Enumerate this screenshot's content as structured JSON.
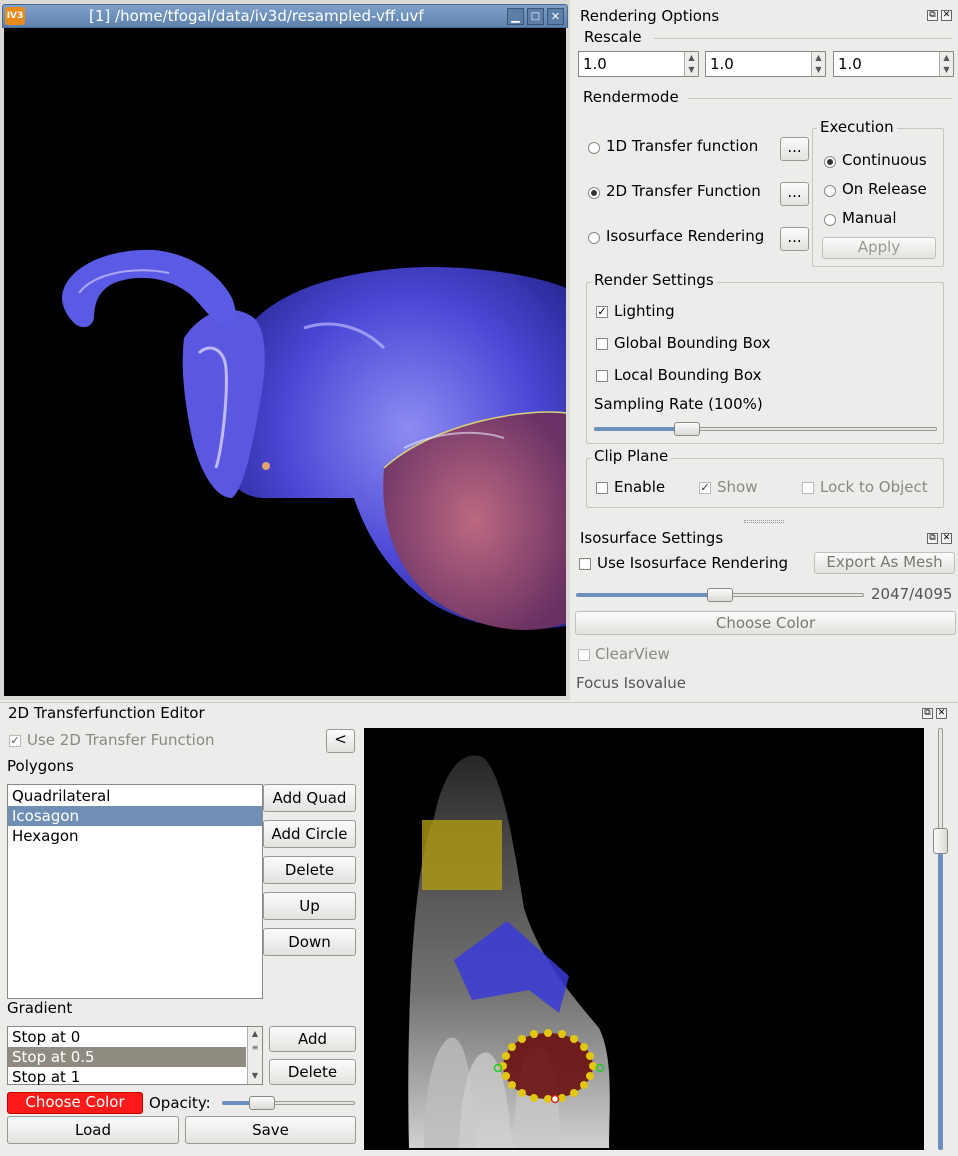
{
  "render_window": {
    "title": "[1] /home/tfogal/data/iv3d/resampled-vff.uvf",
    "logo": "IV3"
  },
  "rendering_options": {
    "title": "Rendering Options",
    "rescale_label": "Rescale",
    "rescale_values": [
      "1.0",
      "1.0",
      "1.0"
    ],
    "rendermode_label": "Rendermode",
    "modes": [
      {
        "label": "1D Transfer function",
        "selected": false
      },
      {
        "label": "2D Transfer Function",
        "selected": true
      },
      {
        "label": "Isosurface Rendering",
        "selected": false
      }
    ],
    "more_button": "...",
    "execution": {
      "label": "Execution",
      "options": [
        {
          "label": "Continuous",
          "selected": true
        },
        {
          "label": "On Release",
          "selected": false
        },
        {
          "label": "Manual",
          "selected": false
        }
      ],
      "apply": "Apply"
    },
    "render_settings": {
      "label": "Render Settings",
      "lighting": {
        "label": "Lighting",
        "checked": true
      },
      "global_bbox": {
        "label": "Global Bounding Box",
        "checked": false
      },
      "local_bbox": {
        "label": "Local Bounding Box",
        "checked": false
      },
      "sampling_label": "Sampling Rate (100%)",
      "sampling_level": 0.27
    },
    "clip_plane": {
      "label": "Clip Plane",
      "enable": {
        "label": "Enable",
        "checked": false
      },
      "show": {
        "label": "Show",
        "checked": true
      },
      "lock": {
        "label": "Lock to Object",
        "checked": false
      }
    }
  },
  "isosurface_settings": {
    "title": "Isosurface Settings",
    "use_label": "Use Isosurface Rendering",
    "export_button": "Export As Mesh",
    "iso_readout": "2047/4095",
    "iso_value": 2047,
    "iso_max": 4095,
    "choose_color": "Choose Color",
    "clearview": "ClearView",
    "focus_isovalue": "Focus Isovalue"
  },
  "tf_editor": {
    "title": "2D Transferfunction Editor",
    "use_label": "Use 2D Transfer Function",
    "collapse_button": "<",
    "polygons_label": "Polygons",
    "polygons": [
      "Quadrilateral",
      "Icosagon",
      "Hexagon"
    ],
    "selected_polygon": 1,
    "buttons": {
      "add_quad": "Add Quad",
      "add_circle": "Add Circle",
      "delete": "Delete",
      "up": "Up",
      "down": "Down"
    },
    "gradient_label": "Gradient",
    "stops": [
      "Stop at 0",
      "Stop at 0.5",
      "Stop at 1"
    ],
    "selected_stop": 1,
    "add_stop": "Add",
    "delete_stop": "Delete",
    "choose_color": "Choose Color",
    "opacity_label": "Opacity:",
    "load": "Load",
    "save": "Save"
  },
  "colors": {
    "accent": "#6b8fbf",
    "choose_color_swatch": "#ff1a1a",
    "volume_blue": "#4a4ad8"
  }
}
